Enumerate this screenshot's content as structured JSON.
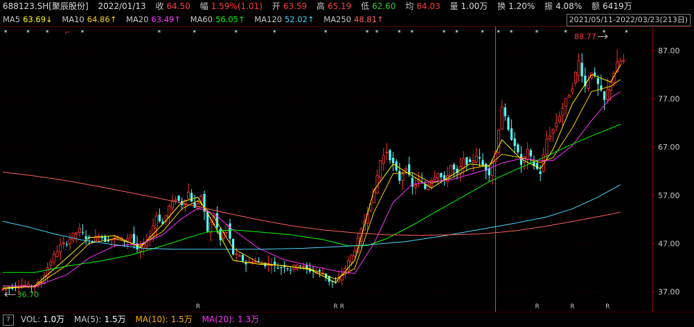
{
  "info_bar": {
    "symbol": "688123.SH[聚辰股份]",
    "date": "2022/01/13",
    "close_label": "收",
    "close": "64.50",
    "change_label": "幅",
    "change": "1.59%(1.01)",
    "open_label": "开",
    "open": "63.59",
    "high_label": "高",
    "high": "65.19",
    "low_label": "低",
    "low": "62.60",
    "avg_label": "均",
    "avg": "64.03",
    "volume_label": "量",
    "volume": "1.00万",
    "turnover_label": "换",
    "turnover": "1.20%",
    "amplitude_label": "振",
    "amplitude": "4.08%",
    "amount_label": "额",
    "amount": "6419万"
  },
  "ma_bar": [
    {
      "name": "MA5",
      "value": "63.69↓",
      "color": "#ffff00"
    },
    {
      "name": "MA10",
      "value": "64.86↑",
      "color": "#ffd000"
    },
    {
      "name": "MA20",
      "value": "63.49↑",
      "color": "#ff33ff"
    },
    {
      "name": "MA60",
      "value": "56.05↑",
      "color": "#00ff00"
    },
    {
      "name": "MA120",
      "value": "52.02↑",
      "color": "#4fd8ff"
    },
    {
      "name": "MA250",
      "value": "48.81↑",
      "color": "#ff6060"
    }
  ],
  "date_range": "2021/05/11-2022/03/23(213日)",
  "vol_bar": {
    "toggle": "?",
    "vol_label": "VOL:",
    "vol_value": "1.0万",
    "ma5_label": "MA(5):",
    "ma5_value": "1.5万",
    "ma10_label": "MA(10):",
    "ma10_value": "1.5万",
    "ma20_label": "MA(20):",
    "ma20_value": "1.3万",
    "colors": {
      "vol": "#ffffff",
      "ma5": "#ffffff",
      "ma10": "#ffb000",
      "ma20": "#ff33ff"
    }
  },
  "chart_data": {
    "type": "candlestick",
    "y_ticks": [
      "87.00",
      "77.00",
      "67.00",
      "57.00",
      "47.00",
      "37.00"
    ],
    "ylim": [
      35.7,
      90.5
    ],
    "x_count": 213,
    "crosshair_x": 154,
    "max_annotation": {
      "text": "88.77",
      "x": 189,
      "value": 88.77
    },
    "min_annotation": {
      "text": "36.70",
      "x": 1,
      "value": 36.7
    },
    "top_markers": [
      {
        "x": 1,
        "t": "*"
      },
      {
        "x": 8,
        "t": "*"
      },
      {
        "x": 14,
        "t": "*"
      },
      {
        "x": 20,
        "t": "⌐"
      },
      {
        "x": 25,
        "t": "*"
      },
      {
        "x": 49,
        "t": "*"
      },
      {
        "x": 60,
        "t": "*"
      },
      {
        "x": 73,
        "t": "*"
      },
      {
        "x": 85,
        "t": "*"
      },
      {
        "x": 101,
        "t": "*"
      },
      {
        "x": 114,
        "t": "*"
      },
      {
        "x": 117,
        "t": "*"
      },
      {
        "x": 124,
        "t": "*"
      },
      {
        "x": 128,
        "t": "*"
      },
      {
        "x": 138,
        "t": "*"
      },
      {
        "x": 142,
        "t": "*"
      },
      {
        "x": 150,
        "t": "*"
      },
      {
        "x": 155,
        "t": "*"
      },
      {
        "x": 159,
        "t": "*"
      },
      {
        "x": 167,
        "t": "*"
      },
      {
        "x": 176,
        "t": "*"
      },
      {
        "x": 188,
        "t": "*"
      },
      {
        "x": 195,
        "t": "*"
      }
    ],
    "bottom_markers": [
      {
        "x": 61,
        "t": "R"
      },
      {
        "x": 104,
        "t": "R"
      },
      {
        "x": 106,
        "t": "R"
      },
      {
        "x": 167,
        "t": "R"
      },
      {
        "x": 178,
        "t": "R"
      },
      {
        "x": 189,
        "t": "R"
      }
    ],
    "candles_ohlc": [],
    "ma_series": [
      {
        "name": "MA5",
        "color": "#ffff00",
        "points": [
          [
            0,
            37.6
          ],
          [
            10,
            38.2
          ],
          [
            20,
            44
          ],
          [
            27,
            48.2
          ],
          [
            35,
            48.6
          ],
          [
            43,
            46.2
          ],
          [
            50,
            51
          ],
          [
            56,
            55.6
          ],
          [
            61,
            56.6
          ],
          [
            66,
            51
          ],
          [
            72,
            43.5
          ],
          [
            80,
            42.7
          ],
          [
            88,
            42.4
          ],
          [
            96,
            41.6
          ],
          [
            104,
            38.9
          ],
          [
            110,
            43.5
          ],
          [
            116,
            58
          ],
          [
            122,
            63.5
          ],
          [
            128,
            61
          ],
          [
            134,
            58.5
          ],
          [
            140,
            61
          ],
          [
            146,
            63.5
          ],
          [
            152,
            63
          ],
          [
            156,
            68.5
          ],
          [
            162,
            64.5
          ],
          [
            168,
            62.5
          ],
          [
            172,
            66.5
          ],
          [
            178,
            76
          ],
          [
            184,
            82
          ],
          [
            190,
            80.5
          ],
          [
            193,
            84
          ]
        ]
      },
      {
        "name": "MA10",
        "color": "#ffd000",
        "points": [
          [
            0,
            37.9
          ],
          [
            10,
            38
          ],
          [
            20,
            42.5
          ],
          [
            27,
            47
          ],
          [
            35,
            48
          ],
          [
            43,
            46.6
          ],
          [
            50,
            49.5
          ],
          [
            56,
            54.2
          ],
          [
            61,
            55.9
          ],
          [
            66,
            52.5
          ],
          [
            72,
            46
          ],
          [
            80,
            43
          ],
          [
            88,
            42.3
          ],
          [
            96,
            41.8
          ],
          [
            104,
            39.6
          ],
          [
            110,
            41.8
          ],
          [
            116,
            53.5
          ],
          [
            122,
            61.5
          ],
          [
            128,
            61.7
          ],
          [
            134,
            59.5
          ],
          [
            140,
            60.5
          ],
          [
            146,
            62.5
          ],
          [
            152,
            63.2
          ],
          [
            156,
            65.5
          ],
          [
            162,
            64.8
          ],
          [
            168,
            63.8
          ],
          [
            172,
            64.8
          ],
          [
            178,
            71
          ],
          [
            184,
            78.5
          ],
          [
            190,
            79.6
          ],
          [
            193,
            81
          ]
        ]
      },
      {
        "name": "MA20",
        "color": "#ff33ff",
        "points": [
          [
            0,
            38.2
          ],
          [
            10,
            38.1
          ],
          [
            20,
            40.5
          ],
          [
            27,
            44
          ],
          [
            35,
            46.5
          ],
          [
            43,
            46.9
          ],
          [
            50,
            48.8
          ],
          [
            56,
            52.2
          ],
          [
            61,
            54.3
          ],
          [
            66,
            53.2
          ],
          [
            72,
            49.8
          ],
          [
            80,
            46
          ],
          [
            88,
            43.6
          ],
          [
            96,
            42.4
          ],
          [
            104,
            41.3
          ],
          [
            110,
            40.8
          ],
          [
            116,
            47
          ],
          [
            122,
            55.5
          ],
          [
            128,
            59.3
          ],
          [
            134,
            59.8
          ],
          [
            140,
            60.2
          ],
          [
            146,
            61.3
          ],
          [
            152,
            62.5
          ],
          [
            156,
            63.7
          ],
          [
            162,
            64.6
          ],
          [
            168,
            64.2
          ],
          [
            172,
            64.2
          ],
          [
            178,
            67.3
          ],
          [
            184,
            72.5
          ],
          [
            190,
            77.2
          ],
          [
            193,
            78.5
          ]
        ]
      },
      {
        "name": "MA60",
        "color": "#00ff00",
        "points": [
          [
            0,
            41
          ],
          [
            10,
            41
          ],
          [
            20,
            42.3
          ],
          [
            30,
            43.3
          ],
          [
            40,
            44.6
          ],
          [
            50,
            46.5
          ],
          [
            58,
            48.2
          ],
          [
            64,
            49.4
          ],
          [
            72,
            49.8
          ],
          [
            80,
            49.4
          ],
          [
            90,
            48.8
          ],
          [
            100,
            47.8
          ],
          [
            108,
            46.5
          ],
          [
            114,
            46.6
          ],
          [
            120,
            48
          ],
          [
            128,
            50.8
          ],
          [
            136,
            53.8
          ],
          [
            144,
            56.8
          ],
          [
            152,
            59.8
          ],
          [
            160,
            62.2
          ],
          [
            168,
            64.5
          ],
          [
            176,
            67
          ],
          [
            184,
            69.3
          ],
          [
            193,
            71.7
          ]
        ]
      },
      {
        "name": "MA120",
        "color": "#4fd8ff",
        "points": [
          [
            0,
            51.6
          ],
          [
            8,
            50.4
          ],
          [
            16,
            49
          ],
          [
            24,
            47.8
          ],
          [
            34,
            46.8
          ],
          [
            44,
            46
          ],
          [
            54,
            45.8
          ],
          [
            66,
            45.8
          ],
          [
            80,
            45.8
          ],
          [
            94,
            46
          ],
          [
            104,
            46.3
          ],
          [
            114,
            46.7
          ],
          [
            126,
            47.4
          ],
          [
            138,
            48.6
          ],
          [
            150,
            50
          ],
          [
            160,
            51.2
          ],
          [
            170,
            52.5
          ],
          [
            178,
            54.2
          ],
          [
            186,
            56.6
          ],
          [
            193,
            59.2
          ]
        ]
      },
      {
        "name": "MA250",
        "color": "#ff6060",
        "points": [
          [
            0,
            61.8
          ],
          [
            10,
            61
          ],
          [
            20,
            60
          ],
          [
            30,
            58.8
          ],
          [
            40,
            57.5
          ],
          [
            50,
            56.2
          ],
          [
            60,
            54.8
          ],
          [
            70,
            53.3
          ],
          [
            80,
            51.9
          ],
          [
            90,
            50.7
          ],
          [
            100,
            49.8
          ],
          [
            110,
            49.2
          ],
          [
            120,
            48.8
          ],
          [
            130,
            48.7
          ],
          [
            140,
            48.8
          ],
          [
            150,
            49
          ],
          [
            160,
            49.6
          ],
          [
            170,
            50.6
          ],
          [
            180,
            51.8
          ],
          [
            188,
            52.8
          ],
          [
            193,
            53.5
          ]
        ]
      }
    ],
    "price_path": [
      [
        0,
        37.5
      ],
      [
        3,
        37.9
      ],
      [
        6,
        38.4
      ],
      [
        9,
        38.1
      ],
      [
        12,
        39
      ],
      [
        14,
        42
      ],
      [
        16,
        44.5
      ],
      [
        18,
        46.5
      ],
      [
        20,
        47.2
      ],
      [
        22,
        48.8
      ],
      [
        24,
        49.8
      ],
      [
        26,
        48.2
      ],
      [
        28,
        47.5
      ],
      [
        30,
        48.9
      ],
      [
        32,
        47.6
      ],
      [
        34,
        47.9
      ],
      [
        36,
        48.2
      ],
      [
        38,
        47.5
      ],
      [
        40,
        48.8
      ],
      [
        42,
        45.4
      ],
      [
        44,
        46.6
      ],
      [
        46,
        48.6
      ],
      [
        48,
        52.8
      ],
      [
        50,
        51
      ],
      [
        52,
        54.6
      ],
      [
        54,
        56.4
      ],
      [
        56,
        55.2
      ],
      [
        58,
        57.6
      ],
      [
        60,
        54.2
      ],
      [
        62,
        56.8
      ],
      [
        64,
        49.6
      ],
      [
        66,
        52.8
      ],
      [
        68,
        47.6
      ],
      [
        70,
        50.8
      ],
      [
        72,
        44.8
      ],
      [
        74,
        44.2
      ],
      [
        76,
        42.8
      ],
      [
        78,
        43.4
      ],
      [
        80,
        43.1
      ],
      [
        82,
        42.6
      ],
      [
        84,
        42.9
      ],
      [
        86,
        41.9
      ],
      [
        88,
        42.3
      ],
      [
        90,
        41.6
      ],
      [
        92,
        42.8
      ],
      [
        94,
        42.1
      ],
      [
        96,
        41.4
      ],
      [
        98,
        41.2
      ],
      [
        100,
        40.9
      ],
      [
        102,
        39.2
      ],
      [
        104,
        38.7
      ],
      [
        106,
        40.6
      ],
      [
        108,
        43.2
      ],
      [
        110,
        45.8
      ],
      [
        112,
        49.6
      ],
      [
        114,
        53.6
      ],
      [
        116,
        57.8
      ],
      [
        118,
        64.2
      ],
      [
        120,
        66.1
      ],
      [
        122,
        63.4
      ],
      [
        124,
        60.2
      ],
      [
        126,
        63
      ],
      [
        128,
        58.6
      ],
      [
        130,
        60.2
      ],
      [
        132,
        58.4
      ],
      [
        134,
        60.4
      ],
      [
        136,
        61.8
      ],
      [
        138,
        59.6
      ],
      [
        140,
        63.2
      ],
      [
        142,
        61.2
      ],
      [
        144,
        64.2
      ],
      [
        146,
        63.4
      ],
      [
        148,
        65.4
      ],
      [
        150,
        63.2
      ],
      [
        152,
        61.6
      ],
      [
        154,
        66.1
      ],
      [
        156,
        75.6
      ],
      [
        158,
        70.2
      ],
      [
        160,
        67.6
      ],
      [
        162,
        63.4
      ],
      [
        164,
        66.1
      ],
      [
        166,
        63.2
      ],
      [
        168,
        61.6
      ],
      [
        170,
        68.6
      ],
      [
        172,
        70.6
      ],
      [
        174,
        73.6
      ],
      [
        176,
        76.6
      ],
      [
        178,
        79.6
      ],
      [
        180,
        84.8
      ],
      [
        182,
        79.6
      ],
      [
        184,
        82.8
      ],
      [
        186,
        79.8
      ],
      [
        188,
        76.6
      ],
      [
        190,
        80.8
      ],
      [
        192,
        84.2
      ],
      [
        193,
        84.8
      ]
    ]
  }
}
